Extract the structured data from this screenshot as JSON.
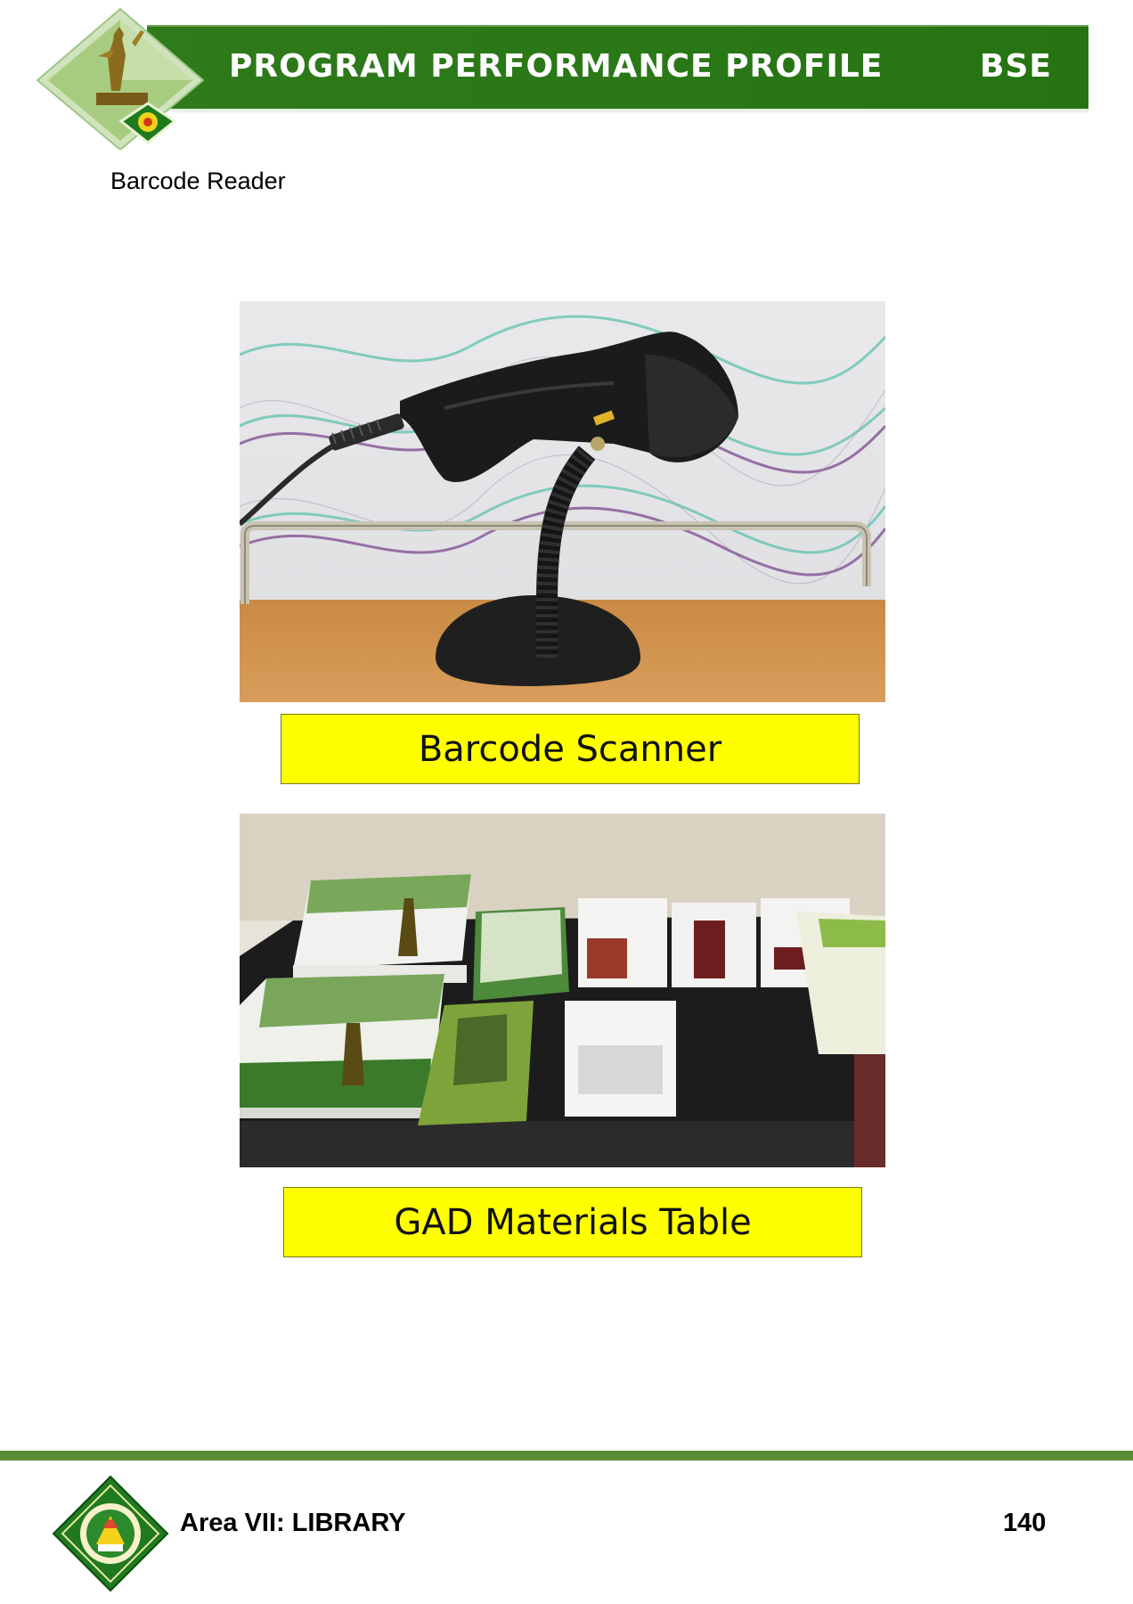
{
  "header": {
    "title": "PROGRAM PERFORMANCE PROFILE",
    "program_code": "BSE",
    "band_color": "#2a7817"
  },
  "section": {
    "heading": "Barcode Reader"
  },
  "figures": [
    {
      "caption": "Barcode Scanner",
      "caption_bg": "#ffff00"
    },
    {
      "caption": "GAD Materials Table",
      "caption_bg": "#ffff00"
    }
  ],
  "footer": {
    "area": "Area VII: LIBRARY",
    "page_number": "140",
    "rule_color": "#5a8b37"
  }
}
